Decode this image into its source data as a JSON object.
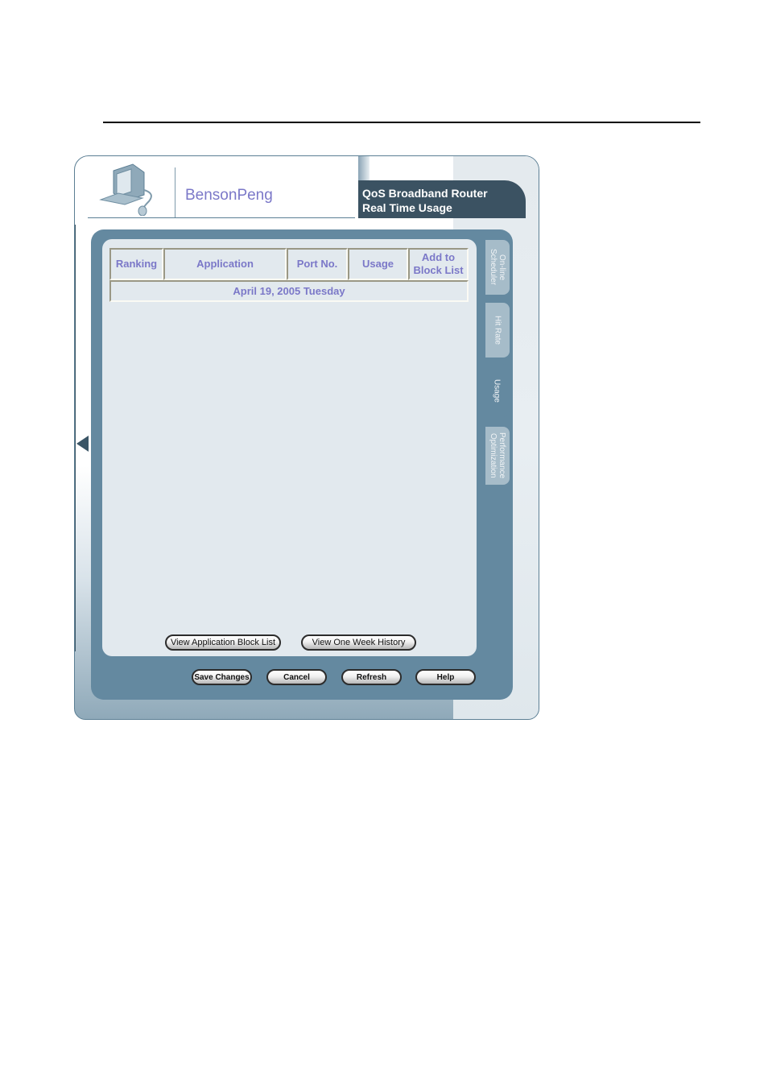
{
  "header": {
    "brand": "BensonPeng",
    "title_line1": "QoS Broadband Router",
    "title_line2": "Real Time Usage"
  },
  "table": {
    "columns": [
      "Ranking",
      "Application",
      "Port No.",
      "Usage",
      "Add to Block List"
    ],
    "date_row": "April 19, 2005 Tuesday",
    "rows": []
  },
  "tabs": [
    {
      "label": "On-line\nScheduler",
      "active": false
    },
    {
      "label": "Hit Rate",
      "active": false
    },
    {
      "label": "Usage",
      "active": true
    },
    {
      "label": "Performance\nOptimization",
      "active": false
    }
  ],
  "panel_buttons": {
    "block_list": "View Application Block List",
    "history": "View One Week History"
  },
  "footer_buttons": {
    "save": "Save Changes",
    "cancel": "Cancel",
    "refresh": "Refresh",
    "help": "Help"
  },
  "icons": {
    "logo": "computer-icon",
    "nav_arrow": "triangle-left-icon"
  }
}
